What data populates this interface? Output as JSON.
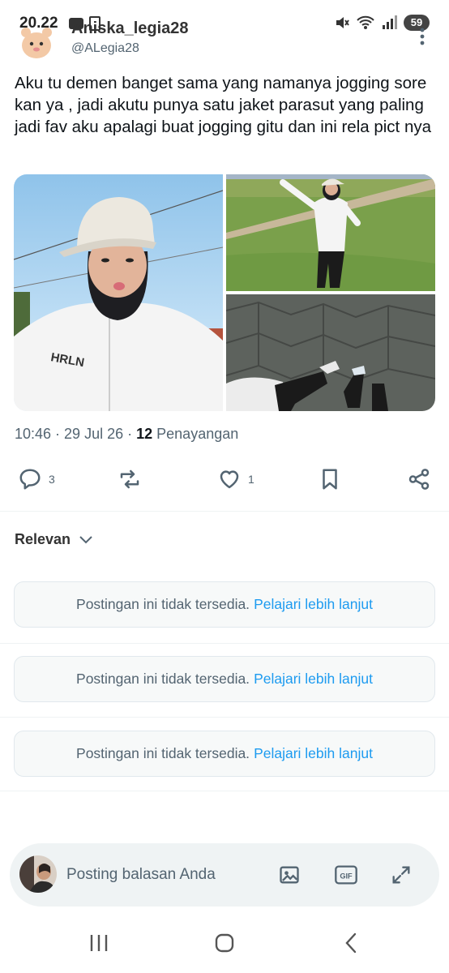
{
  "status": {
    "time": "20.22",
    "battery": "59"
  },
  "author": {
    "name": "Aniska_legia28",
    "handle": "@ALegia28"
  },
  "post": {
    "text": "Aku tu demen banget sama yang namanya jogging sore kan ya , jadi akutu punya satu jaket parasut yang paling jadi fav aku apalagi buat jogging gitu dan ini rela pict nya",
    "time": "10:46",
    "date": "29 Jul 26",
    "views_count": "12",
    "views_label": "Penayangan"
  },
  "actions": {
    "reply_count": "3",
    "like_count": "1"
  },
  "replies": {
    "sort_label": "Relevan",
    "unavailable": [
      {
        "text": "Postingan ini tidak tersedia.",
        "link": "Pelajari lebih lanjut"
      },
      {
        "text": "Postingan ini tidak tersedia.",
        "link": "Pelajari lebih lanjut"
      },
      {
        "text": "Postingan ini tidak tersedia.",
        "link": "Pelajari lebih lanjut"
      }
    ]
  },
  "composer": {
    "placeholder": "Posting balasan Anda",
    "gif_label": "GIF"
  },
  "colors": {
    "accent": "#1d9bf0",
    "muted": "#536471"
  }
}
